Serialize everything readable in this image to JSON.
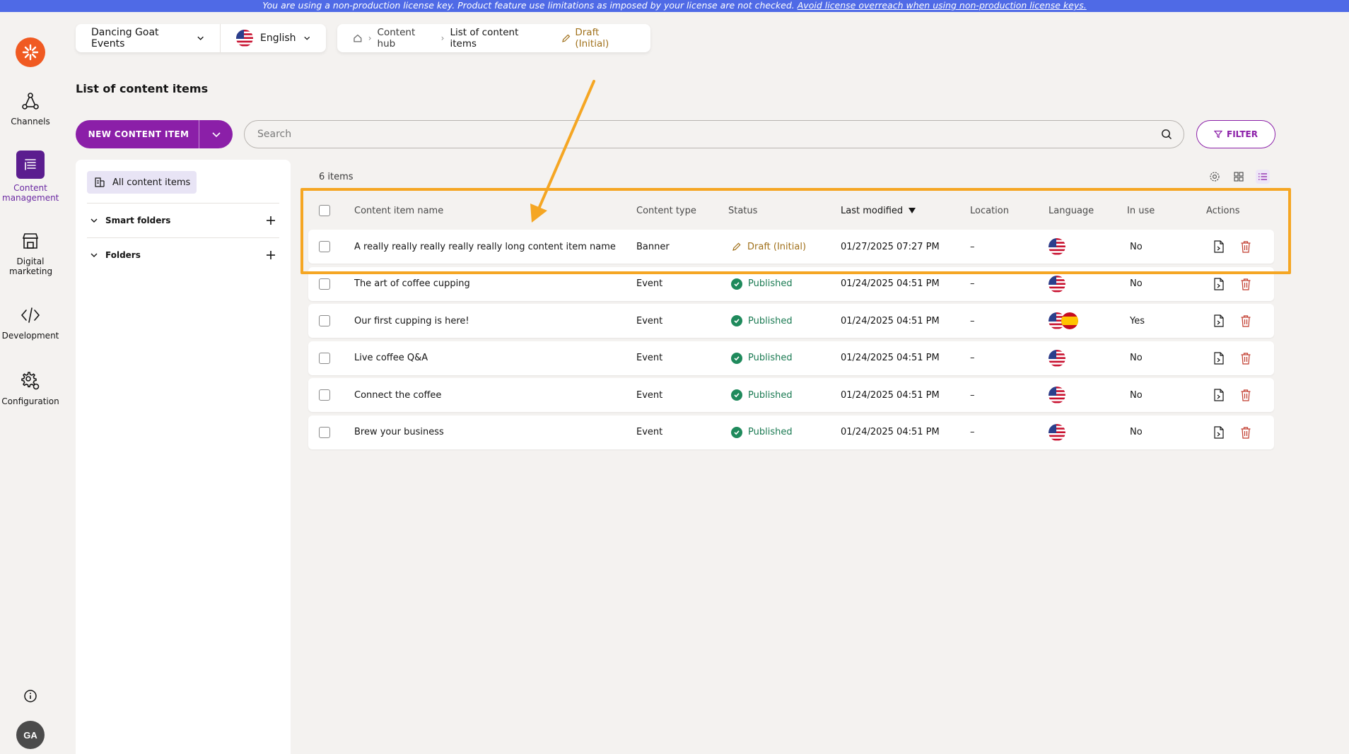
{
  "banner": {
    "text": "You are using a non-production license key. Product feature use limitations as imposed by your license are not checked.",
    "link": "Avoid license overreach when using non-production license keys."
  },
  "nav": {
    "items": [
      {
        "label": "Channels",
        "icon": "channels-icon"
      },
      {
        "label": "Content management",
        "icon": "content-management-icon"
      },
      {
        "label": "Digital marketing",
        "icon": "digital-marketing-icon"
      },
      {
        "label": "Development",
        "icon": "code-icon"
      },
      {
        "label": "Configuration",
        "icon": "gear-icon"
      }
    ],
    "avatar": "GA"
  },
  "topbar": {
    "channel": "Dancing Goat Events",
    "language": "English",
    "breadcrumb": [
      "Content hub",
      "List of content items"
    ],
    "workflow": "Draft (Initial)"
  },
  "page_title": "List of content items",
  "actions": {
    "new_item": "NEW CONTENT ITEM",
    "search_placeholder": "Search",
    "filter": "FILTER"
  },
  "sidebar": {
    "all_items": "All content items",
    "smart_folders": "Smart folders",
    "folders": "Folders"
  },
  "grid": {
    "count": "6 items",
    "headers": [
      "Content item name",
      "Content type",
      "Status",
      "Last modified",
      "Location",
      "Language",
      "In use",
      "Actions"
    ],
    "rows": [
      {
        "name": "A really really really really really long content item name",
        "type": "Banner",
        "status": "Draft (Initial)",
        "status_kind": "draft",
        "modified": "01/27/2025 07:27 PM",
        "location": "–",
        "langs": [
          "us"
        ],
        "in_use": "No"
      },
      {
        "name": "The art of coffee cupping",
        "type": "Event",
        "status": "Published",
        "status_kind": "published",
        "modified": "01/24/2025 04:51 PM",
        "location": "–",
        "langs": [
          "us"
        ],
        "in_use": "No"
      },
      {
        "name": "Our first cupping is here!",
        "type": "Event",
        "status": "Published",
        "status_kind": "published",
        "modified": "01/24/2025 04:51 PM",
        "location": "–",
        "langs": [
          "us",
          "es"
        ],
        "in_use": "Yes"
      },
      {
        "name": "Live coffee Q&A",
        "type": "Event",
        "status": "Published",
        "status_kind": "published",
        "modified": "01/24/2025 04:51 PM",
        "location": "–",
        "langs": [
          "us"
        ],
        "in_use": "No"
      },
      {
        "name": "Connect the coffee",
        "type": "Event",
        "status": "Published",
        "status_kind": "published",
        "modified": "01/24/2025 04:51 PM",
        "location": "–",
        "langs": [
          "us"
        ],
        "in_use": "No"
      },
      {
        "name": "Brew your business",
        "type": "Event",
        "status": "Published",
        "status_kind": "published",
        "modified": "01/24/2025 04:51 PM",
        "location": "–",
        "langs": [
          "us"
        ],
        "in_use": "No"
      }
    ]
  },
  "colors": {
    "brand_purple": "#8b1fa8",
    "published_green": "#1a7a52",
    "draft_amber": "#a0701a",
    "annotation_orange": "#f5a623"
  }
}
